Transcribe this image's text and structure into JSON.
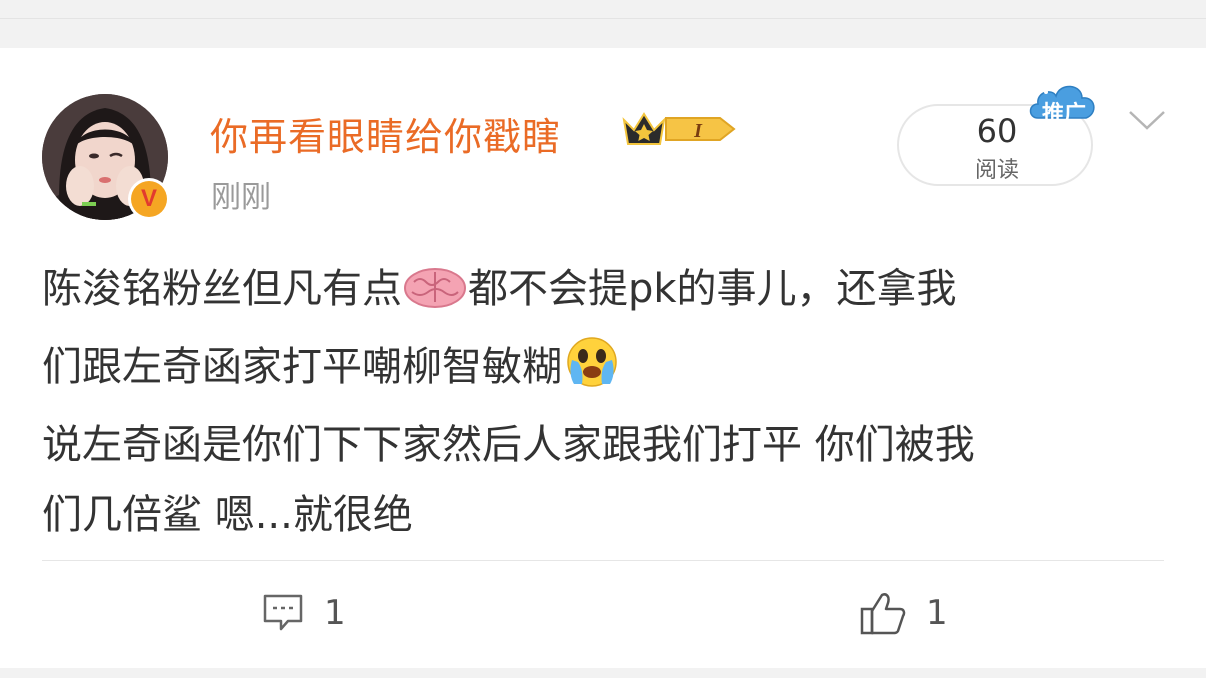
{
  "post": {
    "username": "你再看眼睛给你戳瞎",
    "timestamp": "刚刚",
    "member_level": "I",
    "read_count": "60",
    "read_label": "阅读",
    "promo_label": "推广",
    "text_lines": [
      [
        "陈浚铭粉丝但凡有点",
        "brain-emoji",
        "都不会提pk的事儿，还拿我"
      ],
      [
        "们跟左奇函家打平嘲柳智敏糊",
        "crying-emoji",
        ""
      ],
      [
        "说左奇函是你们下下家然后人家跟我们打平 你们被我",
        "",
        ""
      ],
      [
        "们几倍鲨 嗯...就很绝",
        "",
        ""
      ]
    ],
    "line1a": "陈浚铭粉丝但凡有点",
    "line1b": "都不会提pk的事儿，还拿我",
    "line2": "们跟左奇函家打平嘲柳智敏糊",
    "line3": "说左奇函是你们下下家然后人家跟我们打平 你们被我",
    "line4": "们几倍鲨 嗯...就很绝",
    "comment_count": "1",
    "like_count": "1"
  },
  "icons": {
    "verified": "verified-v-badge",
    "crown": "crown-icon",
    "chevron": "chevron-down-icon",
    "comment": "comment-icon",
    "like": "thumbs-up-icon"
  },
  "colors": {
    "username": "#ea6b26",
    "text": "#333333",
    "muted": "#9a9a9a",
    "promo": "#4a9ee0",
    "verify": "#f5a623"
  }
}
